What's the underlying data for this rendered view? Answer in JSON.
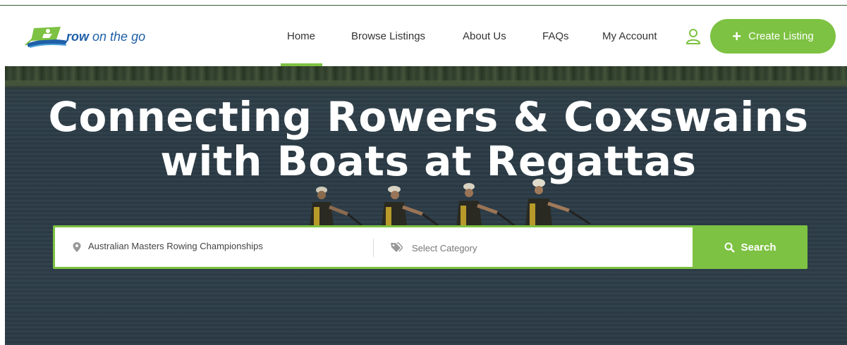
{
  "header": {
    "logo": {
      "bold": "row",
      "rest": " on the go"
    },
    "nav": [
      {
        "label": "Home",
        "active": true
      },
      {
        "label": "Browse Listings"
      },
      {
        "label": "About Us"
      },
      {
        "label": "FAQs"
      },
      {
        "label": "My Account"
      }
    ],
    "user_icon": "user-icon",
    "create_button": {
      "icon": "plus-icon",
      "label": "Create Listing"
    }
  },
  "hero": {
    "title_line1": "Connecting Rowers & Coxswains",
    "title_line2": "with Boats at Regattas",
    "search": {
      "location_icon": "map-pin-icon",
      "location_value": "Australian Masters Rowing Championships",
      "category_icon": "tags-icon",
      "category_placeholder": "Select Category",
      "button_icon": "search-icon",
      "button_label": "Search"
    }
  },
  "colors": {
    "accent": "#7dc242",
    "logo_blue": "#1f5fa8",
    "text": "#333333"
  }
}
